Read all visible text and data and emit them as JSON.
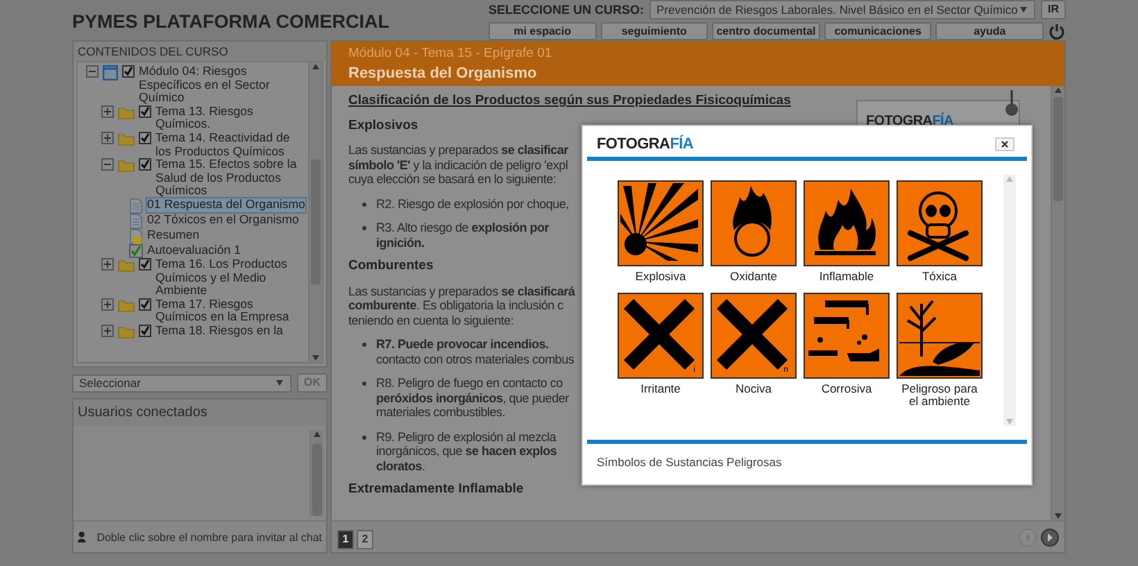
{
  "header": {
    "title": "PYMES PLATAFORMA COMERCIAL",
    "course_label": "SELECCIONE UN CURSO:",
    "course_value": "Prevención de Riesgos Laborales. Nivel Básico en el Sector Químico",
    "go_button": "IR",
    "nav_buttons": [
      "mi espacio",
      "seguimiento",
      "centro documental",
      "comunicaciones",
      "ayuda"
    ]
  },
  "tree": {
    "title": "CONTENIDOS DEL CURSO",
    "items": [
      {
        "kind": "module",
        "label": "Módulo 04: Riesgos Específicos en el Sector Químico",
        "expanded": true,
        "checked": true,
        "selected": false,
        "children": [
          {
            "kind": "topic",
            "label": "Tema 13. Riesgos Químicos.",
            "expanded": false,
            "checked": true,
            "selected": false
          },
          {
            "kind": "topic",
            "label": "Tema 14. Reactividad de los Productos Químicos",
            "expanded": false,
            "checked": true,
            "selected": false
          },
          {
            "kind": "topic",
            "label": "Tema 15. Efectos sobre la Salud de los Productos Químicos",
            "expanded": true,
            "checked": true,
            "selected": false,
            "children": [
              {
                "kind": "page",
                "label": "01 Respuesta del Organismo",
                "selected": true
              },
              {
                "kind": "page",
                "label": "02 Tóxicos en el Organismo",
                "selected": false
              },
              {
                "kind": "summary",
                "label": "Resumen",
                "selected": false
              },
              {
                "kind": "test",
                "label": "Autoevaluación 1",
                "selected": false
              }
            ]
          },
          {
            "kind": "topic",
            "label": "Tema 16. Los Productos Químicos y el Medio Ambiente",
            "expanded": false,
            "checked": true,
            "selected": false
          },
          {
            "kind": "topic",
            "label": "Tema 17. Riesgos Químicos en la Empresa",
            "expanded": false,
            "checked": true,
            "selected": false
          },
          {
            "kind": "topic",
            "label": "Tema 18. Riesgos en la",
            "expanded": false,
            "checked": true,
            "selected": false
          }
        ]
      }
    ]
  },
  "tree_select": {
    "value": "Seleccionar",
    "button": "OK",
    "button_disabled": true
  },
  "users": {
    "title": "Usuarios conectados",
    "hint": "Doble clic sobre el nombre para invitar al chat"
  },
  "content": {
    "breadcrumb": "Módulo 04 - Tema 15 - Epígrafe 01",
    "title": "Respuesta del Organismo",
    "photo_card": {
      "logo_main": "FOTOGRA",
      "logo_accent": "FÍA"
    },
    "blocks": [
      {
        "kind": "link_heading",
        "lines": [
          "Clasificación de los Productos según sus Propiedades Fisicoquímicas"
        ]
      },
      {
        "kind": "heading",
        "lines": [
          "Explosivos"
        ]
      },
      {
        "kind": "paragraph",
        "lines": [
          "Las sustancias y preparados **se clasificar**",
          "**símbolo 'E'** y la indicación de peligro 'expl",
          "cuya elección se basará en lo siguiente:"
        ]
      },
      {
        "kind": "bullet",
        "lines": [
          "R2. Riesgo de explosión por choque,"
        ]
      },
      {
        "kind": "bullet",
        "lines": [
          "R3. Alto riesgo de **explosión por**",
          "**ignición.**"
        ]
      },
      {
        "kind": "heading",
        "lines": [
          "Comburentes"
        ]
      },
      {
        "kind": "paragraph",
        "lines": [
          "Las sustancias y preparados **se clasificará**",
          "**comburente**. Es obligatoria la inclusión c",
          "teniendo en cuenta lo siguiente:"
        ]
      },
      {
        "kind": "bullet",
        "lines": [
          "**R7. Puede provocar incendios.**",
          "contacto con otros materiales combus"
        ]
      },
      {
        "kind": "bullet",
        "lines": [
          "R8. Peligro de fuego en contacto co",
          "**peróxidos inorgánicos**, que pueder",
          "materiales combustibles."
        ]
      },
      {
        "kind": "bullet",
        "lines": [
          "R9. Peligro de explosión al mezcla",
          "inorgánicos, que **se hacen explos**",
          "**cloratos**."
        ]
      },
      {
        "kind": "heading",
        "lines": [
          "Extremadamente Inflamable"
        ]
      }
    ],
    "pages": [
      {
        "label": "1",
        "selected": true
      },
      {
        "label": "2",
        "selected": false
      }
    ]
  },
  "modal": {
    "logo_main": "FOTOGRA",
    "logo_accent": "FÍA",
    "caption": "Símbolos de Sustancias Peligrosas",
    "symbols": [
      {
        "kind": "explosive",
        "label": "Explosiva"
      },
      {
        "kind": "oxidizing",
        "label": "Oxidante"
      },
      {
        "kind": "flammable",
        "label": "Inflamable"
      },
      {
        "kind": "toxic",
        "label": "Tóxica"
      },
      {
        "kind": "cross",
        "label": "Irritante",
        "corner_letter": "i"
      },
      {
        "kind": "cross",
        "label": "Nociva",
        "corner_letter": "n"
      },
      {
        "kind": "corrosive",
        "label": "Corrosiva"
      },
      {
        "kind": "environment",
        "label": "Peligroso para el ambiente"
      }
    ]
  }
}
